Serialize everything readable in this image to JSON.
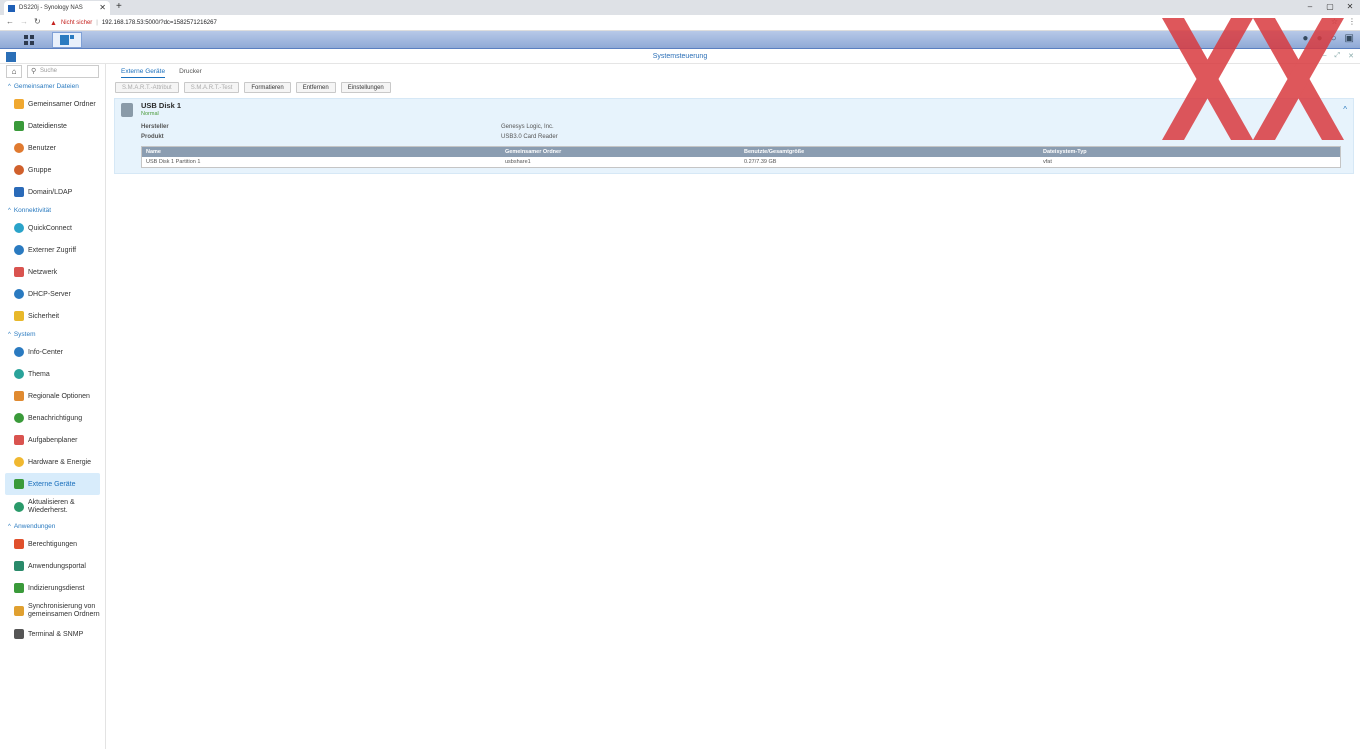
{
  "browser": {
    "tab_title": "DS220j - Synology NAS",
    "tab_close": "✕",
    "new_tab": "+",
    "url_warning": "Nicht sicher",
    "url_host": "192.168.178.53",
    "url_path": ":5000/?launchApp=SYNO.SDS.AdminCenter.Application&launchParam=fn%3DSYNO.SDS.AdminCenter.ExternalDevice.Main",
    "url_display": "192.168.178.53:5000/?dc=1582571216267",
    "back": "←",
    "forward": "→",
    "reload": "↻",
    "star": "☆",
    "menu": "⋮",
    "minimize": "–",
    "restore": "▢",
    "close": "✕"
  },
  "window": {
    "title": "Systemsteuerung",
    "ctl_min": "–",
    "ctl_max": "⤢",
    "ctl_close": "✕"
  },
  "sidebar": {
    "search_placeholder": "Suche",
    "sections": {
      "shared": "Gemeinsamer Dateien",
      "connectivity": "Konnektivität",
      "system": "System",
      "apps": "Anwendungen"
    },
    "items": {
      "shared_folder": "Gemeinsamer Ordner",
      "file_services": "Dateidienste",
      "user": "Benutzer",
      "group": "Gruppe",
      "domain": "Domain/LDAP",
      "quickconnect": "QuickConnect",
      "external_access": "Externer Zugriff",
      "network": "Netzwerk",
      "dhcp": "DHCP-Server",
      "security": "Sicherheit",
      "info_center": "Info-Center",
      "theme": "Thema",
      "regional": "Regionale Optionen",
      "notification": "Benachrichtigung",
      "task_scheduler": "Aufgabenplaner",
      "hardware": "Hardware & Energie",
      "external_devices": "Externe Geräte",
      "update_line1": "Aktualisieren &",
      "update_line2": "Wiederherst.",
      "privileges": "Berechtigungen",
      "app_portal": "Anwendungsportal",
      "indexing": "Indizierungsdienst",
      "sync_line1": "Synchronisierung von",
      "sync_line2": "gemeinsamen Ordnern",
      "terminal": "Terminal & SNMP"
    }
  },
  "main": {
    "tabs": [
      "Externe Geräte",
      "Drucker"
    ],
    "toolbar": {
      "smart_attr": "S.M.A.R.T.-Attribut",
      "smart_test": "S.M.A.R.T.-Test",
      "format": "Formatieren",
      "remove": "Entfernen",
      "settings": "Einstellungen"
    },
    "device": {
      "name": "USB Disk 1",
      "status": "Normal",
      "manufacturer_label": "Hersteller",
      "manufacturer_value": "Genesys Logic, Inc.",
      "product_label": "Produkt",
      "product_value": "USB3.0 Card Reader"
    },
    "table": {
      "headers": [
        "Name",
        "Gemeinsamer Ordner",
        "Benutzte/Gesamtgröße",
        "Dateisystem-Typ"
      ],
      "rows": [
        [
          "USB Disk 1 Partition 1",
          "usbshare1",
          "0.27/7.39 GB",
          "vfat"
        ]
      ]
    }
  },
  "colors": {
    "accent": "#2b7bc0",
    "selected_bg": "#d8ecfb",
    "overlay_x": "#d93a3f"
  }
}
